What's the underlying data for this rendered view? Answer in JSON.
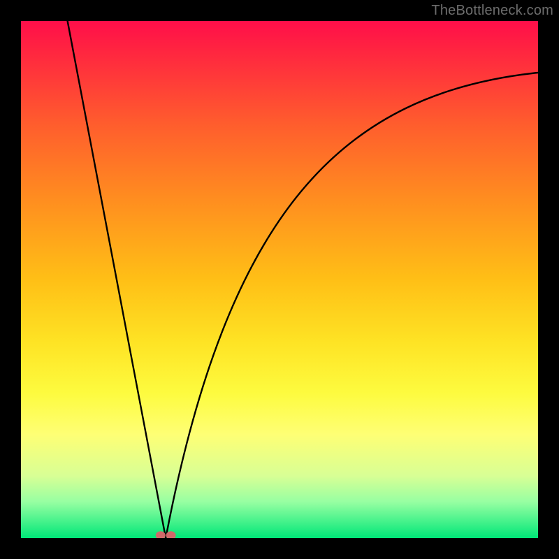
{
  "watermark": "TheBottleneck.com",
  "chart_data": {
    "type": "line",
    "title": "",
    "xlabel": "",
    "ylabel": "",
    "xlim": [
      0,
      100
    ],
    "ylim": [
      0,
      100
    ],
    "notch_x": 28.0,
    "background_gradient": {
      "top": "#ff0e4a",
      "bottom": "#00e778",
      "type": "red-to-green"
    },
    "series": [
      {
        "name": "left-branch",
        "x": [
          9,
          12,
          15,
          18,
          21,
          24,
          27,
          28
        ],
        "values": [
          100,
          84,
          68,
          53,
          37,
          21,
          5,
          0
        ]
      },
      {
        "name": "right-branch",
        "x": [
          28,
          29,
          31,
          34,
          38,
          43,
          49,
          56,
          64,
          73,
          83,
          94,
          100
        ],
        "values": [
          0,
          6,
          17,
          30,
          43,
          54,
          63,
          71,
          77,
          82,
          86,
          89,
          90
        ]
      },
      {
        "name": "marker-at-notch",
        "x": [
          27.0,
          29.0
        ],
        "values": [
          0.5,
          0.5
        ]
      }
    ],
    "curve": {
      "left": [
        {
          "x": 9,
          "y": 100
        },
        {
          "x": 28,
          "y": 0
        }
      ],
      "right_bezier": {
        "p0": {
          "x": 28,
          "y": 0
        },
        "c1": {
          "x": 40,
          "y": 63
        },
        "c2": {
          "x": 62,
          "y": 86
        },
        "p1": {
          "x": 100,
          "y": 90
        }
      }
    },
    "marker": {
      "cx1": 27.0,
      "cx2": 29.0,
      "cy": 0.5,
      "color": "#d06a6a"
    }
  }
}
